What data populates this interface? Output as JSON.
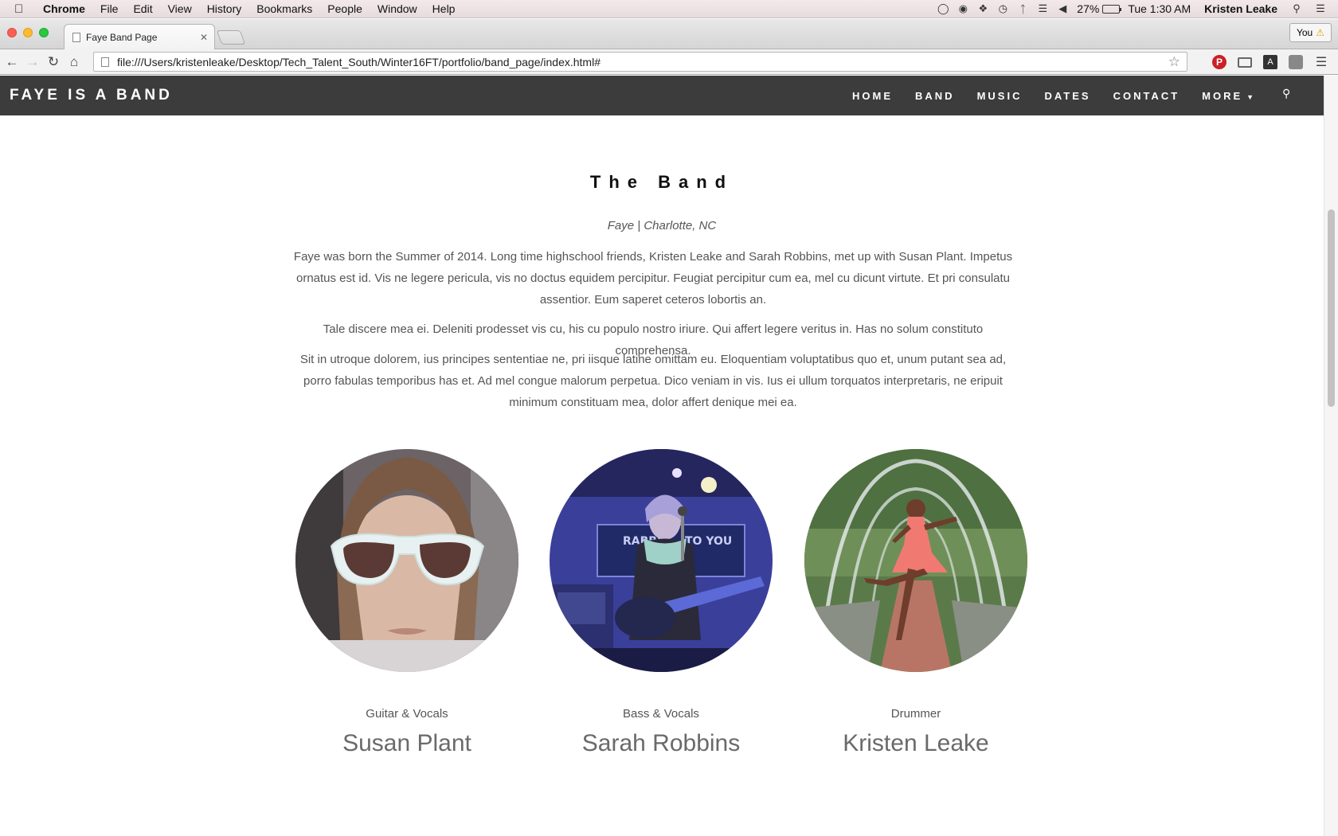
{
  "macos": {
    "app_name": "Chrome",
    "menus": [
      "File",
      "Edit",
      "View",
      "History",
      "Bookmarks",
      "People",
      "Window",
      "Help"
    ],
    "battery_percent": "27%",
    "battery_level": 0.27,
    "clock": "Tue 1:30 AM",
    "user": "Kristen Leake"
  },
  "chrome": {
    "tab_title": "Faye Band Page",
    "profile_label": "You",
    "url": "file:///Users/kristenleake/Desktop/Tech_Talent_South/Winter16FT/portfolio/band_page/index.html#"
  },
  "site": {
    "brand": "FAYE IS A BAND",
    "nav": [
      "HOME",
      "BAND",
      "MUSIC",
      "DATES",
      "CONTACT",
      "MORE"
    ],
    "section_title": "The Band",
    "subtitle": "Faye | Charlotte, NC",
    "paragraphs": [
      "Faye was born the Summer of 2014. Long time highschool friends, Kristen Leake and Sarah Robbins, met up with Susan Plant. Impetus ornatus est id. Vis ne legere pericula, vis no doctus equidem percipitur. Feugiat percipitur cum ea, mel cu dicunt virtute. Et pri consulatu assentior. Eum saperet ceteros lobortis an.",
      "Tale discere mea ei. Deleniti prodesset vis cu, his cu populo nostro iriure. Qui affert legere veritus in. Has no solum constituto comprehensa.",
      "Sit in utroque dolorem, ius principes sententiae ne, pri iisque latine omittam eu. Eloquentiam voluptatibus quo et, unum putant sea ad, porro fabulas temporibus has et. Ad mel congue malorum perpetua. Dico veniam in vis. Ius ei ullum torquatos interpretaris, ne eripuit minimum constituam mea, dolor affert denique mei ea."
    ],
    "members": [
      {
        "role": "Guitar & Vocals",
        "name": "Susan Plant"
      },
      {
        "role": "Bass & Vocals",
        "name": "Sarah Robbins"
      },
      {
        "role": "Drummer",
        "name": "Kristen Leake"
      }
    ],
    "photo_sign_1": "RABBIT",
    "photo_sign_2": "TO YOU"
  },
  "colors": {
    "navbar": "#3c3c3d",
    "text": "#555555",
    "name": "#6a6a6a"
  }
}
